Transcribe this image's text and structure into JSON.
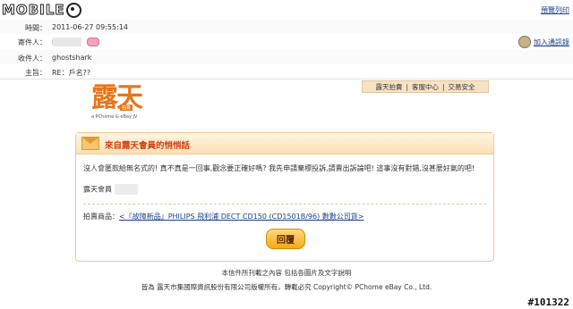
{
  "header": {
    "logo_text": "MOBILE",
    "print_label": "預覽列印"
  },
  "meta": {
    "time_label": "時間：",
    "time_value": "2011-06-27 09:55:14",
    "from_label": "寄件人：",
    "from_prefix": "i",
    "add_contact": "加入通訊錄",
    "to_label": "收件人：",
    "to_value": "ghostshark",
    "subject_label": "主旨：",
    "subject_value": "RE：戶名??"
  },
  "tabs": [
    "露天拍賣",
    "客服中心",
    "交易安全"
  ],
  "brand": {
    "name": "露天",
    "badge": "拍賣",
    "sub": "a PChome & eBay JV"
  },
  "card": {
    "title": "來自露天會員的悄悄話",
    "message": "沒人會匿款給無名式的! 真不真是一回事,觀念要正確好嗎? 我先申請棄標投訴,請賣出訴論吧! 這事沒有對錯,沒甚麼好氣的吧!",
    "sender_label": "露天會員",
    "product_label": "拍賣商品：",
    "product_link": "<『故障新品』PHILIPS 飛利浦 DECT CD150 (CD1501B/96) 數數公司貨>",
    "reply_label": "回覆"
  },
  "footer": {
    "line1": "本信件所刊載之內容 包括各圖片及文字說明",
    "line2": "皆為 露天市集國際資訊股份有限公司版權所有，轉載必究 Copyright©   PChome eBay Co., Ltd."
  },
  "watermark": "#101322"
}
